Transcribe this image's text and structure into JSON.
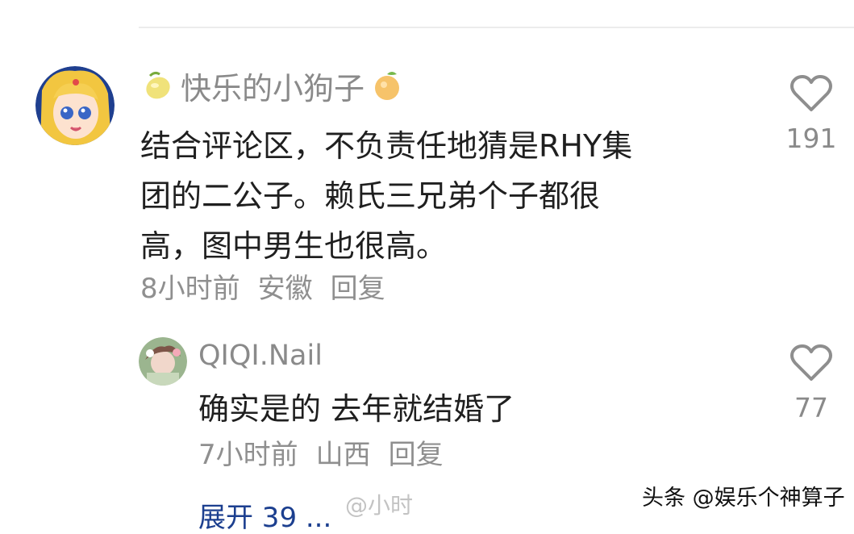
{
  "comments": [
    {
      "username": "快乐的小狗子",
      "username_prefix_icon": "lemon-icon",
      "username_suffix_icon": "orange-icon",
      "text_lines": [
        "结合评论区，不负责任地猜是RHY集",
        "团的二公子。赖氏三兄弟个子都很",
        "高，图中男生也很高。"
      ],
      "time": "8小时前",
      "location": "安徽",
      "reply_label": "回复",
      "like_count": "191",
      "like_icon": "heart-outline-icon"
    },
    {
      "username": "QIQI.Nail",
      "text": "确实是的 去年就结婚了",
      "time": "7小时前",
      "location": "山西",
      "reply_label": "回复",
      "like_count": "77",
      "like_icon": "heart-outline-icon"
    }
  ],
  "expand": {
    "label": "展开 39 ..."
  },
  "watermarks": {
    "center": "@小时",
    "right": "头条 @娱乐个神算子"
  },
  "colors": {
    "text": "#1f1f1f",
    "muted": "#8a8a8a",
    "link": "#1c3f8f",
    "divider": "#ececec"
  }
}
